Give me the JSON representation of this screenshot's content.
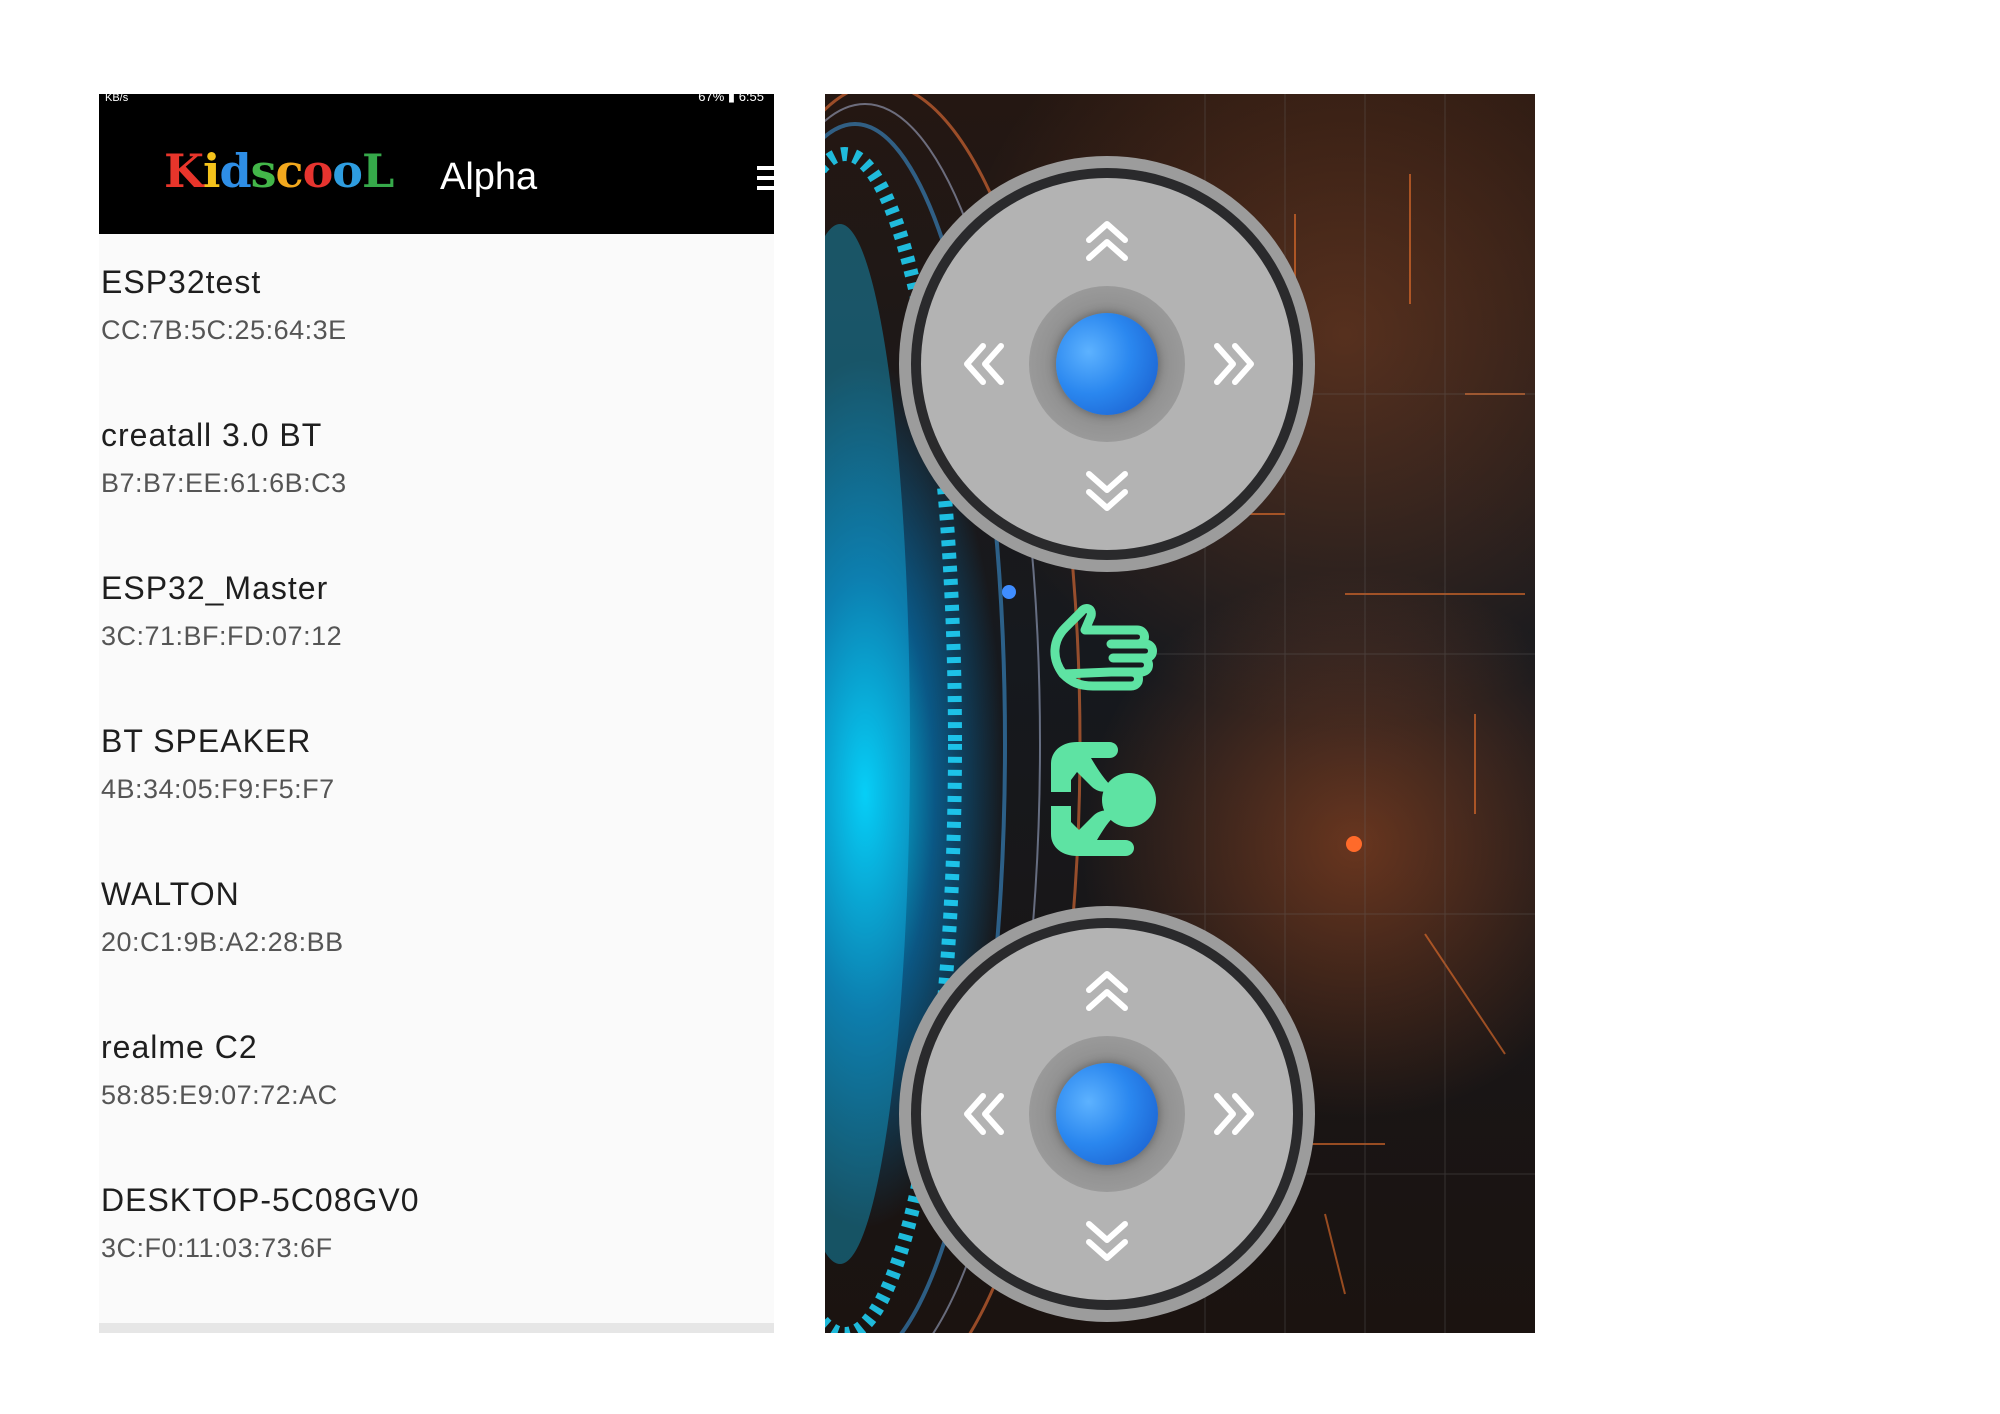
{
  "status_bar": {
    "left": "KB/s",
    "right": "67% ▮ 6:55"
  },
  "header": {
    "logo_letters": [
      "K",
      "i",
      "d",
      "s",
      "c",
      "o",
      "o",
      "L"
    ],
    "logo_colors": [
      "#e8352b",
      "#f4c21b",
      "#2e8ee6",
      "#43b649",
      "#f2a81d",
      "#e6342f",
      "#2e9de0",
      "#36a94a"
    ],
    "logo_text": "KidscooL",
    "title": "Alpha",
    "menu_icon": "hamburger-menu-icon"
  },
  "devices": [
    {
      "name": "ESP32test",
      "mac": "CC:7B:5C:25:64:3E"
    },
    {
      "name": "creatall 3.0 BT",
      "mac": "B7:B7:EE:61:6B:C3"
    },
    {
      "name": "ESP32_Master",
      "mac": "3C:71:BF:FD:07:12"
    },
    {
      "name": "BT SPEAKER",
      "mac": "4B:34:05:F9:F5:F7"
    },
    {
      "name": "WALTON",
      "mac": "20:C1:9B:A2:28:BB"
    },
    {
      "name": "realme C2",
      "mac": "58:85:E9:07:72:AC"
    },
    {
      "name": "DESKTOP-5C08GV0",
      "mac": "3C:F0:11:03:73:6F"
    }
  ],
  "controller": {
    "joysticks": [
      "top-joystick",
      "bottom-joystick"
    ],
    "arrow_icons": [
      "chevron-double-up-icon",
      "chevron-double-down-icon",
      "chevron-double-left-icon",
      "chevron-double-right-icon"
    ],
    "action_buttons": [
      "grab-hand-icon",
      "release-hand-icon"
    ],
    "colors": {
      "action": "#5ee3a3",
      "knob": "#2a87ef",
      "pad": "#b3b3b3",
      "ring": "#9c9c9c"
    }
  }
}
